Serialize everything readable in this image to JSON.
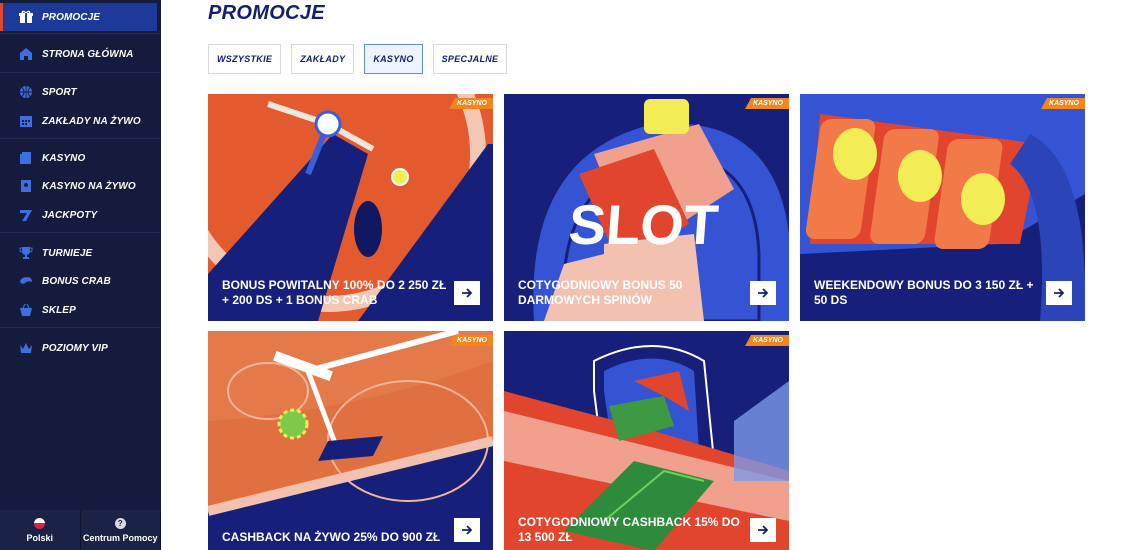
{
  "sidebar": {
    "items": [
      {
        "label": "PROMOCJE",
        "icon": "gift-icon",
        "active": true
      },
      {
        "label": "STRONA GŁÓWNA",
        "icon": "home-icon"
      },
      {
        "label": "SPORT",
        "icon": "basketball-icon"
      },
      {
        "label": "ZAKŁADY NA ŻYWO",
        "icon": "live-calendar-icon"
      },
      {
        "label": "KASYNO",
        "icon": "cards-icon"
      },
      {
        "label": "KASYNO NA ŻYWO",
        "icon": "live-cards-icon"
      },
      {
        "label": "JACKPOTY",
        "icon": "seven-icon"
      },
      {
        "label": "TURNIEJE",
        "icon": "trophy-icon"
      },
      {
        "label": "BONUS CRAB",
        "icon": "crab-icon"
      },
      {
        "label": "SKLEP",
        "icon": "basket-icon"
      },
      {
        "label": "POZIOMY VIP",
        "icon": "crown-icon"
      }
    ],
    "footer": {
      "language_label": "Polski",
      "help_label": "Centrum Pomocy"
    }
  },
  "main": {
    "title": "PROMOCJE",
    "tabs": [
      {
        "label": "WSZYSTKIE"
      },
      {
        "label": "ZAKŁADY"
      },
      {
        "label": "KASYNO",
        "active": true
      },
      {
        "label": "SPECJALNE"
      }
    ],
    "cards": [
      {
        "title": "BONUS POWITALNY 100% DO 2 250 ZŁ + 200 DS + 1 BONUS CRAB",
        "badge": "KASYNO",
        "art": "roulette"
      },
      {
        "title": "COTYGODNIOWY BONUS 50 DARMOWYCH SPINÓW",
        "badge": "KASYNO",
        "art": "slot",
        "art_text": "SLOT"
      },
      {
        "title": "WEEKENDOWY BONUS DO 3 150 ZŁ + 50 DS",
        "badge": "KASYNO",
        "art": "lemons"
      },
      {
        "title": "CASHBACK NA ŻYWO 25% DO 900 ZŁ",
        "badge": "KASYNO",
        "art": "table"
      },
      {
        "title": "COTYGODNIOWY CASHBACK 15% DO 13 500 ZŁ",
        "badge": "KASYNO",
        "art": "cash"
      }
    ]
  },
  "colors": {
    "sidebar_bg": "#141b3c",
    "active_item_bg": "#1d3a9a",
    "accent_orange": "#f2861c",
    "navy": "#14206b"
  }
}
